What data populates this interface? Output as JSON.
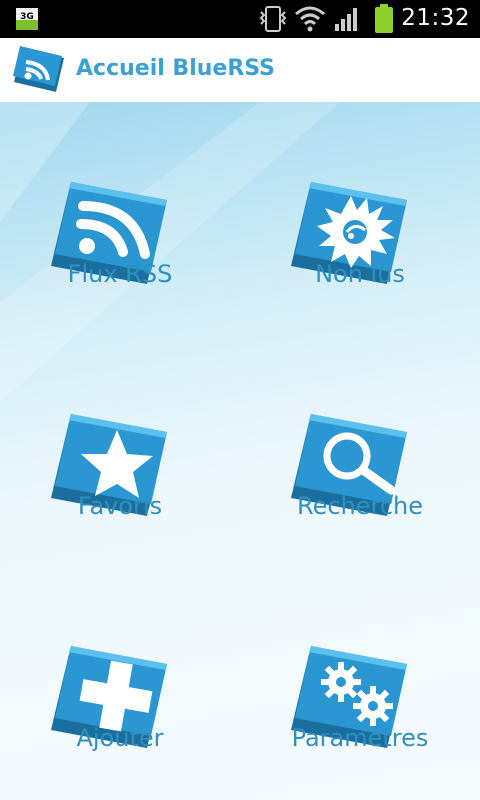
{
  "status_bar": {
    "network_label": "3G",
    "time": "21:32",
    "icons": [
      "vibrate-icon",
      "wifi-icon",
      "signal-icon",
      "battery-icon"
    ]
  },
  "action_bar": {
    "title": "Accueil BlueRSS",
    "logo_icon": "rss-logo-icon"
  },
  "menu": {
    "items": [
      {
        "label": "Flux RSS",
        "icon": "rss-icon"
      },
      {
        "label": "Non lus",
        "icon": "burst-icon"
      },
      {
        "label": "Favoris",
        "icon": "star-icon"
      },
      {
        "label": "Recherche",
        "icon": "magnifier-icon"
      },
      {
        "label": "Ajouter",
        "icon": "plus-icon"
      },
      {
        "label": "Paramètres",
        "icon": "gears-icon"
      }
    ]
  },
  "colors": {
    "accent": "#3ba0d2",
    "tile_blue": "#2a97d2",
    "tile_dark": "#1b6f9f",
    "background_light": "#eef8fc"
  }
}
